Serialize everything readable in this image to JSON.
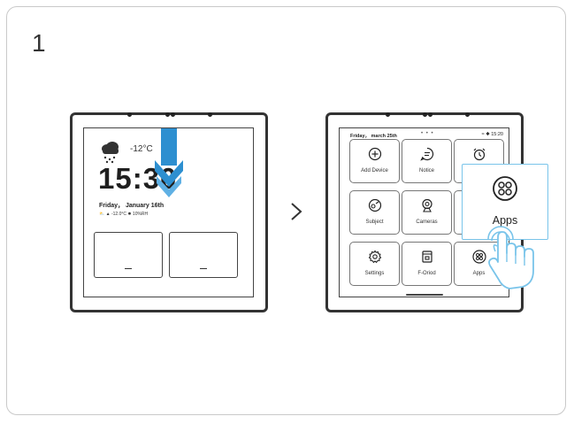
{
  "step": {
    "number": "1"
  },
  "lock_screen": {
    "temperature": "-12°C",
    "time": "15:30",
    "date": "Friday， January 16th",
    "weather_details": "-12.0°C  ✹ 10%RH"
  },
  "home_screen": {
    "status_date": "Friday， march 25th",
    "status_dots": "• • •",
    "status_right": "≈ ✱ 15:20",
    "tiles": [
      {
        "label": "Add Device",
        "icon": "plus-circle-icon"
      },
      {
        "label": "Notice",
        "icon": "message-icon"
      },
      {
        "label": "",
        "icon": "alarm-clock-icon"
      },
      {
        "label": "Subject",
        "icon": "subject-icon"
      },
      {
        "label": "Cameras",
        "icon": "camera-icon"
      },
      {
        "label": "",
        "icon": "hidden-icon"
      },
      {
        "label": "Settings",
        "icon": "gear-icon"
      },
      {
        "label": "F-Oriod",
        "icon": "hub-icon"
      },
      {
        "label": "Apps",
        "icon": "apps-grid-icon"
      }
    ]
  },
  "apps_popup": {
    "label": "Apps",
    "icon": "apps-grid-icon"
  },
  "colors": {
    "highlight": "#79c4ea",
    "swipe_arrow": "#2d8fd0",
    "frame": "#333333"
  }
}
